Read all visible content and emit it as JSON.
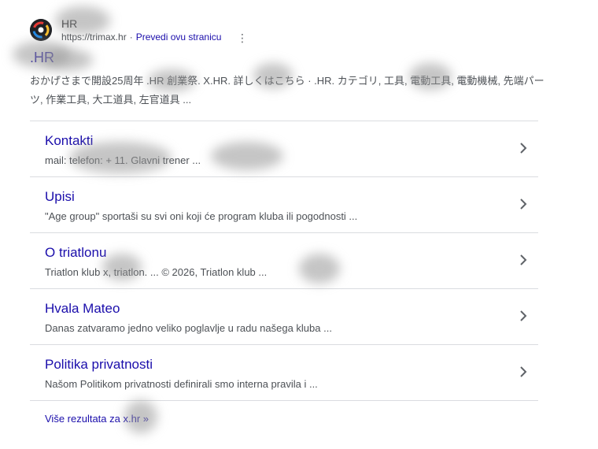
{
  "result": {
    "site_name": "HR",
    "url": "https://trimax.hr",
    "separator": "·",
    "translate_label": "Prevedi ovu stranicu",
    "menu_icon": "more-vert-icon",
    "title": ".HR",
    "snippet": "おかげさまで開設25周年 .HR 創業祭. X.HR. 詳しくはこちら · .HR. カテゴリ, 工具, 電動工具, 電動機械, 先端パーツ, 作業工具, 大工道具, 左官道具 ..."
  },
  "sitelinks": [
    {
      "title": "Kontakti",
      "desc": "mail:                          telefon: +                 11. Glavni trener ..."
    },
    {
      "title": "Upisi",
      "desc": "\"Age group\" sportaši su svi oni koji će program kluba ili pogodnosti ..."
    },
    {
      "title": "O triatlonu",
      "desc": "Triatlon klub          x, triatlon. ... © 2026, Triatlon klub          ..."
    },
    {
      "title": "Hvala Mateo",
      "desc": "Danas zatvaramo jedno veliko poglavlje u radu našega kluba ..."
    },
    {
      "title": "Politika privatnosti",
      "desc": "Našom Politikom privatnosti definirali smo interna pravila i ..."
    }
  ],
  "more_results": "Više rezultata za        x.hr »",
  "colors": {
    "link": "#1a0dab",
    "text": "#4d5156",
    "divider": "#dadce0"
  }
}
